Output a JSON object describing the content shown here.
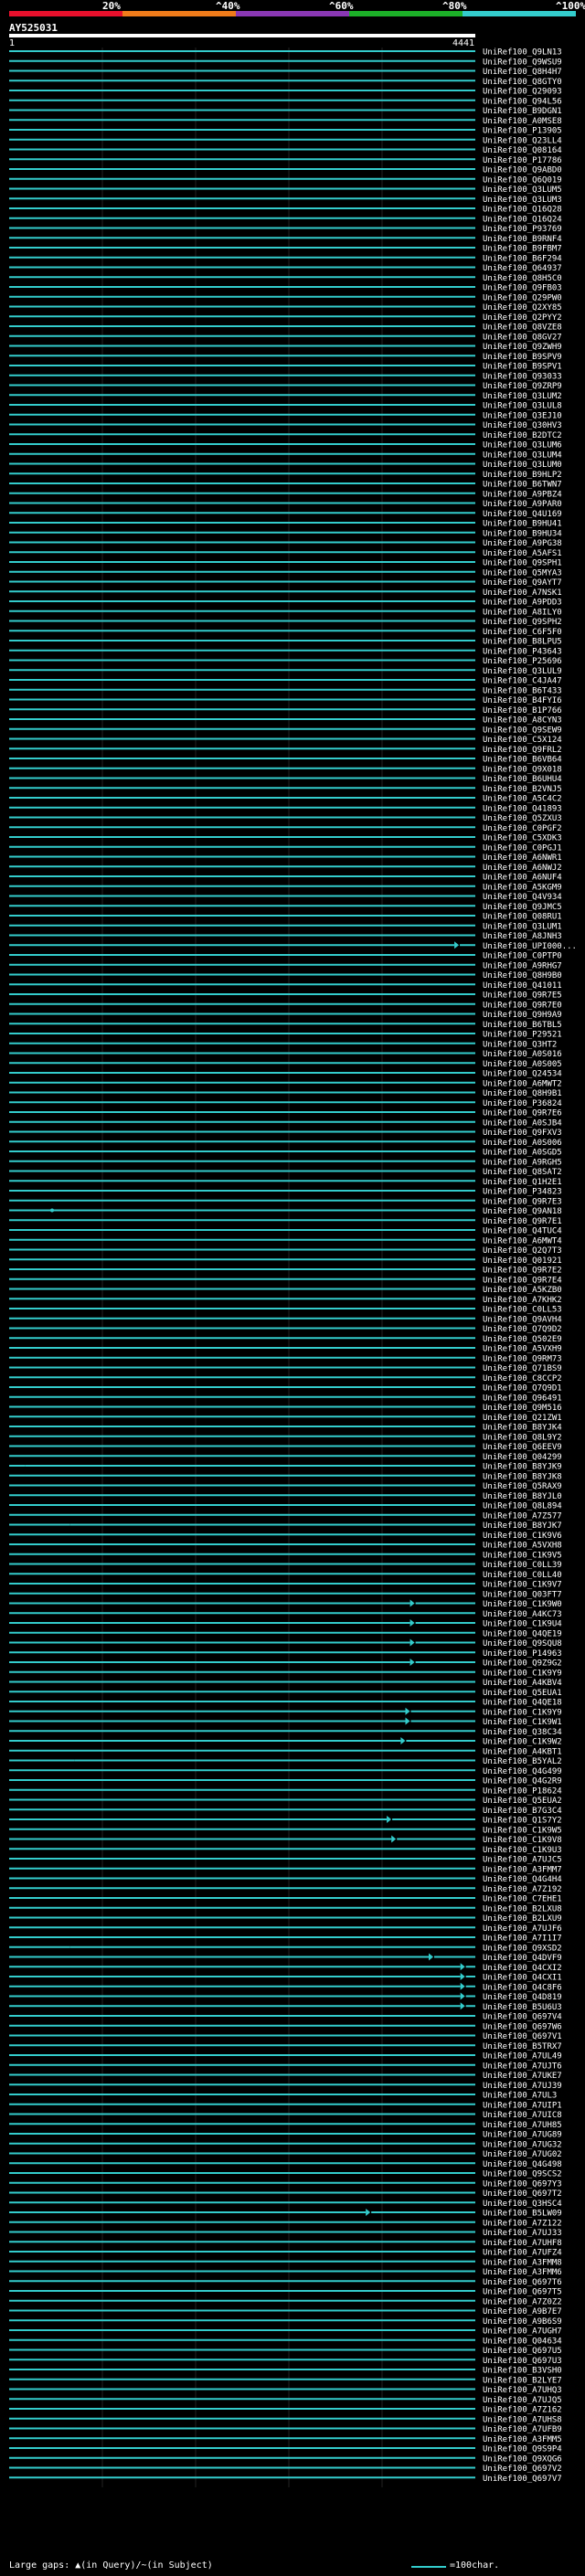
{
  "legend": {
    "labels": [
      "20%",
      "^40%",
      "^60%",
      "^80%",
      "^100%"
    ],
    "colors": [
      "#e8102c",
      "#f07b1a",
      "#8a38b4",
      "#1cb028",
      "#33cccc"
    ]
  },
  "query": {
    "name": "AY525031",
    "start": "1",
    "end": "4441"
  },
  "footer": {
    "gaps_text": "Large gaps: ▲(in Query)/~(in Subject)",
    "scale_text": "=100char."
  },
  "chart_data": {
    "type": "alignment",
    "query_length": 4441,
    "default_color": "#33cccc",
    "hits": [
      {
        "label": "UniRef100_Q9LN13"
      },
      {
        "label": "UniRef100_Q9WSU9"
      },
      {
        "label": "UniRef100_Q8H4H7"
      },
      {
        "label": "UniRef100_Q8GTY0"
      },
      {
        "label": "UniRef100_Q29093"
      },
      {
        "label": "UniRef100_Q94L56"
      },
      {
        "label": "UniRef100_B9DGN1"
      },
      {
        "label": "UniRef100_A0MSE8"
      },
      {
        "label": "UniRef100_P13905"
      },
      {
        "label": "UniRef100_Q23LL4"
      },
      {
        "label": "UniRef100_Q08164"
      },
      {
        "label": "UniRef100_P17786"
      },
      {
        "label": "UniRef100_Q9ABD0"
      },
      {
        "label": "UniRef100_Q6Q019"
      },
      {
        "label": "UniRef100_Q3LUM5"
      },
      {
        "label": "UniRef100_Q3LUM3"
      },
      {
        "label": "UniRef100_Q16Q28"
      },
      {
        "label": "UniRef100_Q16Q24"
      },
      {
        "label": "UniRef100_P93769"
      },
      {
        "label": "UniRef100_B9RNF4"
      },
      {
        "label": "UniRef100_B9FBM7"
      },
      {
        "label": "UniRef100_B6F294"
      },
      {
        "label": "UniRef100_Q64937"
      },
      {
        "label": "UniRef100_Q8H5C0"
      },
      {
        "label": "UniRef100_Q9FB03"
      },
      {
        "label": "UniRef100_Q29PW0"
      },
      {
        "label": "UniRef100_Q2XY85"
      },
      {
        "label": "UniRef100_Q2PYY2"
      },
      {
        "label": "UniRef100_Q8VZE8"
      },
      {
        "label": "UniRef100_Q8GV27"
      },
      {
        "label": "UniRef100_Q9ZWH9"
      },
      {
        "label": "UniRef100_B9SPV9"
      },
      {
        "label": "UniRef100_B9SPV1"
      },
      {
        "label": "UniRef100_Q93033"
      },
      {
        "label": "UniRef100_Q9ZRP9"
      },
      {
        "label": "UniRef100_Q3LUM2"
      },
      {
        "label": "UniRef100_Q3LUL8"
      },
      {
        "label": "UniRef100_Q3EJ10"
      },
      {
        "label": "UniRef100_Q30HV3"
      },
      {
        "label": "UniRef100_B2DTC2"
      },
      {
        "label": "UniRef100_Q3LUM6"
      },
      {
        "label": "UniRef100_Q3LUM4"
      },
      {
        "label": "UniRef100_Q3LUM0"
      },
      {
        "label": "UniRef100_B9HLP2"
      },
      {
        "label": "UniRef100_B6TWN7"
      },
      {
        "label": "UniRef100_A9PBZ4"
      },
      {
        "label": "UniRef100_A9PAR0"
      },
      {
        "label": "UniRef100_Q4U169"
      },
      {
        "label": "UniRef100_B9HU41"
      },
      {
        "label": "UniRef100_B9HU34"
      },
      {
        "label": "UniRef100_A9PG38"
      },
      {
        "label": "UniRef100_A5AFS1"
      },
      {
        "label": "UniRef100_Q9SPH1"
      },
      {
        "label": "UniRef100_Q5MYA3"
      },
      {
        "label": "UniRef100_Q9AYT7"
      },
      {
        "label": "UniRef100_A7NSK1"
      },
      {
        "label": "UniRef100_A9PDD3"
      },
      {
        "label": "UniRef100_A8ILY0"
      },
      {
        "label": "UniRef100_Q9SPH2"
      },
      {
        "label": "UniRef100_C6F5F0"
      },
      {
        "label": "UniRef100_B8LPU5"
      },
      {
        "label": "UniRef100_P43643"
      },
      {
        "label": "UniRef100_P25696"
      },
      {
        "label": "UniRef100_Q3LUL9"
      },
      {
        "label": "UniRef100_C4JA47"
      },
      {
        "label": "UniRef100_B6T433"
      },
      {
        "label": "UniRef100_B4FYI6"
      },
      {
        "label": "UniRef100_B1P766"
      },
      {
        "label": "UniRef100_A8CYN3"
      },
      {
        "label": "UniRef100_Q9SEW9"
      },
      {
        "label": "UniRef100_C5X124"
      },
      {
        "label": "UniRef100_Q9FRL2"
      },
      {
        "label": "UniRef100_B6VB64"
      },
      {
        "label": "UniRef100_Q9X018"
      },
      {
        "label": "UniRef100_B6UHU4"
      },
      {
        "label": "UniRef100_B2VNJ5"
      },
      {
        "label": "UniRef100_A5C4C2"
      },
      {
        "label": "UniRef100_Q41893"
      },
      {
        "label": "UniRef100_Q5ZXU3"
      },
      {
        "label": "UniRef100_C0PGF2"
      },
      {
        "label": "UniRef100_C5XDK3"
      },
      {
        "label": "UniRef100_C0PGJ1"
      },
      {
        "label": "UniRef100_A6NWR1"
      },
      {
        "label": "UniRef100_A6NWJ2"
      },
      {
        "label": "UniRef100_A6NUF4"
      },
      {
        "label": "UniRef100_A5KGM9"
      },
      {
        "label": "UniRef100_Q4V934"
      },
      {
        "label": "UniRef100_Q9JMC5"
      },
      {
        "label": "UniRef100_Q08RU1"
      },
      {
        "label": "UniRef100_Q3LUM1"
      },
      {
        "label": "UniRef100_A8JNH3"
      },
      {
        "label": "UniRef100_UPI000...",
        "color": "#33cccc",
        "end_frac": 0.955,
        "arrow": true
      },
      {
        "label": "UniRef100_C0PTP0"
      },
      {
        "label": "UniRef100_A9RHG7"
      },
      {
        "label": "UniRef100_Q8H9B0"
      },
      {
        "label": "UniRef100_Q41011"
      },
      {
        "label": "UniRef100_Q9R7E5"
      },
      {
        "label": "UniRef100_Q9R7E0"
      },
      {
        "label": "UniRef100_Q9H9A9"
      },
      {
        "label": "UniRef100_B6TBL5"
      },
      {
        "label": "UniRef100_P29521"
      },
      {
        "label": "UniRef100_Q3HT2"
      },
      {
        "label": "UniRef100_A0S016"
      },
      {
        "label": "UniRef100_A0S005"
      },
      {
        "label": "UniRef100_Q24534"
      },
      {
        "label": "UniRef100_A6MWT2"
      },
      {
        "label": "UniRef100_Q8H9B1"
      },
      {
        "label": "UniRef100_P36824"
      },
      {
        "label": "UniRef100_Q9R7E6"
      },
      {
        "label": "UniRef100_A0SJB4"
      },
      {
        "label": "UniRef100_Q9FXV3"
      },
      {
        "label": "UniRef100_A0S006"
      },
      {
        "label": "UniRef100_A0SGD5"
      },
      {
        "label": "UniRef100_A9RGH5"
      },
      {
        "label": "UniRef100_Q8SAT2"
      },
      {
        "label": "UniRef100_Q1H2E1"
      },
      {
        "label": "UniRef100_P34823"
      },
      {
        "label": "UniRef100_Q9R7E3"
      },
      {
        "label": "UniRef100_Q9AN18"
      },
      {
        "label": "UniRef100_Q9R7E1"
      },
      {
        "label": "UniRef100_Q4TUC4"
      },
      {
        "label": "UniRef100_A6MWT4"
      },
      {
        "label": "UniRef100_Q2Q7T3"
      },
      {
        "label": "UniRef100_Q01921"
      },
      {
        "label": "UniRef100_Q9R7E2"
      },
      {
        "label": "UniRef100_Q9R7E4"
      },
      {
        "label": "UniRef100_A5KZB0"
      },
      {
        "label": "UniRef100_A7KHK2"
      },
      {
        "label": "UniRef100_C0LL53"
      },
      {
        "label": "UniRef100_Q9AVH4"
      },
      {
        "label": "UniRef100_Q7Q9D2"
      },
      {
        "label": "UniRef100_Q502E9"
      },
      {
        "label": "UniRef100_A5VXH9"
      },
      {
        "label": "UniRef100_Q9RM73"
      },
      {
        "label": "UniRef100_Q71BS9"
      },
      {
        "label": "UniRef100_C8CCP2"
      },
      {
        "label": "UniRef100_Q7Q9D1"
      },
      {
        "label": "UniRef100_Q96491"
      },
      {
        "label": "UniRef100_Q9M516"
      },
      {
        "label": "UniRef100_Q21ZW1"
      },
      {
        "label": "UniRef100_B8YJK4"
      },
      {
        "label": "UniRef100_Q8L9Y2"
      },
      {
        "label": "UniRef100_Q6EEV9"
      },
      {
        "label": "UniRef100_Q04299"
      },
      {
        "label": "UniRef100_B8YJK9"
      },
      {
        "label": "UniRef100_B8YJK8"
      },
      {
        "label": "UniRef100_Q5RAX9"
      },
      {
        "label": "UniRef100_B8YJL0"
      },
      {
        "label": "UniRef100_Q8L894"
      },
      {
        "label": "UniRef100_A7Z577"
      },
      {
        "label": "UniRef100_B8YJK7"
      },
      {
        "label": "UniRef100_C1K9V6"
      },
      {
        "label": "UniRef100_A5VXH8"
      },
      {
        "label": "UniRef100_C1K9V5"
      },
      {
        "label": "UniRef100_C0LL39"
      },
      {
        "label": "UniRef100_C0LL40"
      },
      {
        "label": "UniRef100_C1K9V7"
      },
      {
        "label": "UniRef100_Q03FT7"
      },
      {
        "label": "UniRef100_C1K9W0"
      },
      {
        "label": "UniRef100_A4KC73"
      },
      {
        "label": "UniRef100_C1K9U4"
      },
      {
        "label": "UniRef100_Q4QE19"
      },
      {
        "label": "UniRef100_Q9SQU8"
      },
      {
        "label": "UniRef100_P14963"
      },
      {
        "label": "UniRef100_Q9Z9G2"
      },
      {
        "label": "UniRef100_C1K9Y9"
      },
      {
        "label": "UniRef100_A4KBV4"
      },
      {
        "label": "UniRef100_Q5EUA1"
      },
      {
        "label": "UniRef100_Q4QE18"
      },
      {
        "label": "UniRef100_C1K9Y9"
      },
      {
        "label": "UniRef100_C1K9W1"
      },
      {
        "label": "UniRef100_Q38C34"
      },
      {
        "label": "UniRef100_C1K9W2"
      },
      {
        "label": "UniRef100_A4KBT1"
      },
      {
        "label": "UniRef100_B5YAL2"
      },
      {
        "label": "UniRef100_Q4G499"
      },
      {
        "label": "UniRef100_Q4G2R9"
      },
      {
        "label": "UniRef100_P18624"
      },
      {
        "label": "UniRef100_Q5EUA2"
      },
      {
        "label": "UniRef100_B7G3C4"
      },
      {
        "label": "UniRef100_Q1S7Y2"
      },
      {
        "label": "UniRef100_C1K9W5"
      },
      {
        "label": "UniRef100_C1K9V8"
      },
      {
        "label": "UniRef100_C1K9U3"
      },
      {
        "label": "UniRef100_A7UJC5"
      },
      {
        "label": "UniRef100_A3FMM7"
      },
      {
        "label": "UniRef100_Q4G4H4"
      },
      {
        "label": "UniRef100_A7Z192"
      },
      {
        "label": "UniRef100_C7EHE1"
      },
      {
        "label": "UniRef100_B2LXU8"
      },
      {
        "label": "UniRef100_B2LXU9"
      },
      {
        "label": "UniRef100_A7UJF6"
      },
      {
        "label": "UniRef100_A7I1I7"
      },
      {
        "label": "UniRef100_Q9XSD2",
        "color": "#33cccc",
        "end_frac": 0.968,
        "arrow": true
      },
      {
        "label": "UniRef100_Q4DVF9",
        "color": "#33cccc",
        "end_frac": 0.968,
        "arrow": true
      },
      {
        "label": "UniRef100_Q4CXI2",
        "color": "#33cccc",
        "end_frac": 0.968,
        "arrow": true
      },
      {
        "label": "UniRef100_Q4CXI1",
        "color": "#33cccc",
        "end_frac": 0.968,
        "arrow": true
      },
      {
        "label": "UniRef100_Q4C8F6",
        "color": "#33cccc",
        "end_frac": 0.968,
        "arrow": true
      },
      {
        "label": "UniRef100_Q4D819",
        "color": "#33cccc",
        "end_frac": 0.968,
        "arrow": true
      },
      {
        "label": "UniRef100_B5U6U3",
        "color": "#33cccc",
        "end_frac": 0.968,
        "arrow": true
      },
      {
        "label": "UniRef100_Q697V4"
      },
      {
        "label": "UniRef100_Q697W6"
      },
      {
        "label": "UniRef100_Q697V1"
      },
      {
        "label": "UniRef100_B5TRX7"
      },
      {
        "label": "UniRef100_A7UL49"
      },
      {
        "label": "UniRef100_A7UJT6"
      },
      {
        "label": "UniRef100_A7UKE7"
      },
      {
        "label": "UniRef100_A7UJ39"
      },
      {
        "label": "UniRef100_A7UL3"
      },
      {
        "label": "UniRef100_A7UIP1"
      },
      {
        "label": "UniRef100_A7UIC8"
      },
      {
        "label": "UniRef100_A7UH85"
      },
      {
        "label": "UniRef100_A7UG89"
      },
      {
        "label": "UniRef100_A7UG32"
      },
      {
        "label": "UniRef100_A7UG02"
      },
      {
        "label": "UniRef100_Q4G498"
      },
      {
        "label": "UniRef100_Q9SCS2"
      },
      {
        "label": "UniRef100_Q697Y3"
      },
      {
        "label": "UniRef100_Q697T2"
      },
      {
        "label": "UniRef100_Q3HSC4"
      },
      {
        "label": "UniRef100_B5LW09",
        "color": "#33cccc",
        "end_frac": 0.765,
        "arrow": true
      },
      {
        "label": "UniRef100_A7Z122"
      },
      {
        "label": "UniRef100_A7UJ33"
      },
      {
        "label": "UniRef100_A7UHF8"
      },
      {
        "label": "UniRef100_A7UFZ4"
      },
      {
        "label": "UniRef100_A3FMM8"
      },
      {
        "label": "UniRef100_A3FMM6"
      },
      {
        "label": "UniRef100_Q697T6"
      },
      {
        "label": "UniRef100_Q697T5"
      },
      {
        "label": "UniRef100_A7Z0Z2"
      },
      {
        "label": "UniRef100_A9B7E7"
      },
      {
        "label": "UniRef100_A9B6S9"
      },
      {
        "label": "UniRef100_A7UGH7"
      },
      {
        "label": "UniRef100_Q04634"
      },
      {
        "label": "UniRef100_Q697U5"
      },
      {
        "label": "UniRef100_Q697U3"
      },
      {
        "label": "UniRef100_B3VSH0"
      },
      {
        "label": "UniRef100_B2LYE7"
      },
      {
        "label": "UniRef100_A7UHQ3"
      },
      {
        "label": "UniRef100_A7UJQ5"
      },
      {
        "label": "UniRef100_A7Z162"
      },
      {
        "label": "UniRef100_A7UHS8"
      },
      {
        "label": "UniRef100_A7UFB9"
      },
      {
        "label": "UniRef100_A3FMM5"
      },
      {
        "label": "UniRef100_Q9S9P4"
      },
      {
        "label": "UniRef100_Q9XQG6"
      },
      {
        "label": "UniRef100_Q697V2"
      },
      {
        "label": "UniRef100_Q697V7"
      }
    ],
    "partial_hits": {
      "144": {
        "start_frac": 0.0,
        "end_frac": 0.035,
        "gap": true
      },
      "150": {
        "start_frac": 0.0,
        "end_frac": 0.13,
        "gap": true
      },
      "158": {
        "start_frac": 0.0,
        "end_frac": 0.86,
        "arrow": true
      },
      "160": {
        "start_frac": 0.0,
        "end_frac": 0.86,
        "arrow": true
      },
      "162": {
        "start_frac": 0.0,
        "end_frac": 0.86,
        "arrow": true
      },
      "164": {
        "start_frac": 0.0,
        "end_frac": 0.86,
        "arrow": true
      },
      "166": {
        "start_frac": 0.0,
        "end_frac": 0.1,
        "gap": true
      },
      "167": {
        "start_frac": 0.0,
        "end_frac": 0.1,
        "gap": true
      },
      "169": {
        "start_frac": 0.0,
        "end_frac": 0.85,
        "arrow": true
      },
      "170": {
        "start_frac": 0.0,
        "end_frac": 0.85,
        "arrow": true
      },
      "172": {
        "start_frac": 0.0,
        "end_frac": 0.84,
        "arrow": true
      },
      "174": {
        "start_frac": 0.0,
        "end_frac": 0.14,
        "gap": true
      },
      "176": {
        "start_frac": 0.0,
        "end_frac": 0.1,
        "gap": true
      },
      "180": {
        "start_frac": 0.0,
        "end_frac": 0.81,
        "arrow": true
      },
      "182": {
        "start_frac": 0.0,
        "end_frac": 0.82,
        "arrow": true
      },
      "193": {
        "start_frac": 0.0,
        "end_frac": 0.13,
        "gap": true
      },
      "194": {
        "start_frac": 0.0,
        "end_frac": 0.9,
        "arrow": true
      }
    },
    "pink_hits": [
      97,
      100
    ]
  }
}
